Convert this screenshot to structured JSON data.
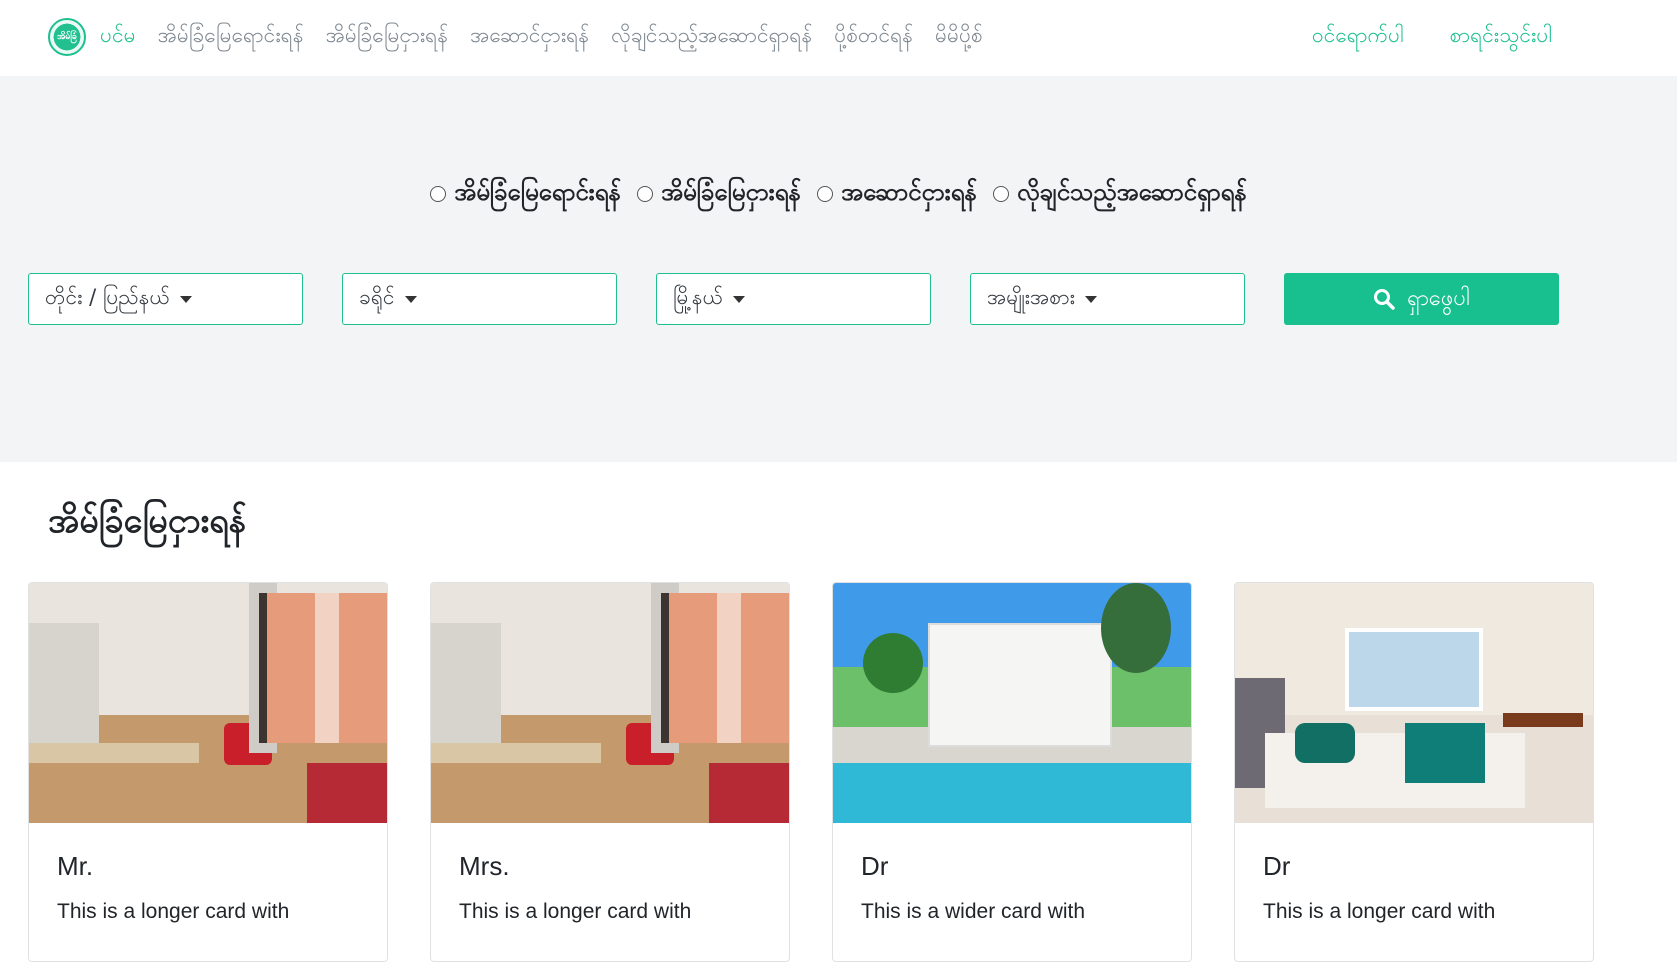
{
  "navbar": {
    "brand_label": "ပင်မ",
    "logo_text": "အိမ်ခြံ",
    "links": [
      "အိမ်ခြံမြေရောင်းရန်",
      "အိမ်ခြံမြေငှားရန်",
      "အဆောင်ငှားရန်",
      "လိုချင်သည့်အဆောင်ရှာရန်",
      "ပို့စ်တင်ရန်",
      "မိမိပို့စ်"
    ],
    "right": [
      "ဝင်ရောက်ပါ",
      "စာရင်းသွင်းပါ"
    ]
  },
  "search": {
    "radios": [
      "အိမ်ခြံမြေရောင်းရန်",
      "အိမ်ခြံမြေငှားရန်",
      "အဆောင်ငှားရန်",
      "လိုချင်သည့်အဆောင်ရှာရန်"
    ],
    "selects": [
      "တိုင်း / ပြည်နယ်",
      "ခရိုင်",
      "မြို့နယ်",
      "အမျိုးအစား"
    ],
    "button_label": "ရှာဖွေပါ",
    "accent_color": "#1fbf8f"
  },
  "section": {
    "title": "အိမ်ခြံမြေငှားရန်",
    "cards": [
      {
        "title": "Mr.",
        "text": "This is a longer card with",
        "image": "living-room"
      },
      {
        "title": "Mrs.",
        "text": "This is a longer card with",
        "image": "living-room"
      },
      {
        "title": "Dr",
        "text": "This is a wider card with",
        "image": "house-with-pool"
      },
      {
        "title": "Dr",
        "text": "This is a longer card with",
        "image": "bedroom"
      }
    ]
  }
}
